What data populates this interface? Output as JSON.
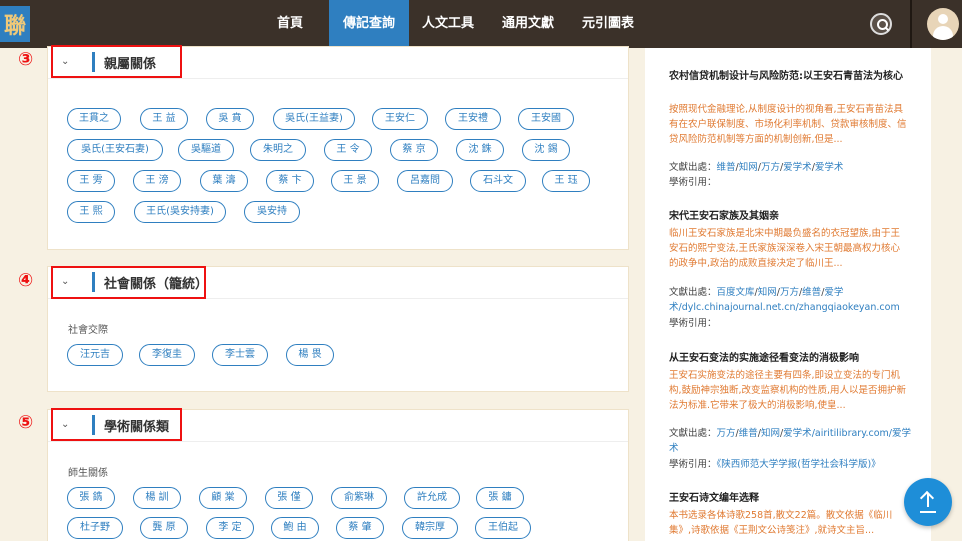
{
  "nav": {
    "logo_glyph": "聯",
    "items": [
      {
        "label": "首頁",
        "active": false
      },
      {
        "label": "傳記查詢",
        "active": true
      },
      {
        "label": "人文工具",
        "active": false
      },
      {
        "label": "通用文獻",
        "active": false
      },
      {
        "label": "元引圖表",
        "active": false
      }
    ]
  },
  "sections": [
    {
      "marker": "③",
      "title": "親屬關係",
      "groups": [
        {
          "label": "",
          "tags": [
            "王貫之",
            "王 益",
            "吳 賁",
            "吳氏(王益妻)",
            "王安仁",
            "王安禮",
            "王安國",
            "吳氏(王安石妻)",
            "吳驅道",
            "朱明之",
            "王 令",
            "蔡 京",
            "沈 銖",
            "沈 錫",
            "王 雱",
            "王 滂",
            "葉 濤",
            "蔡 卞",
            "王 景",
            "呂嘉問",
            "石斗文",
            "王 珏",
            "王 熙",
            "王氏(吳安持妻)",
            "吳安持"
          ]
        }
      ]
    },
    {
      "marker": "④",
      "title": "社會關係（籠統）",
      "groups": [
        {
          "label": "社會交際",
          "tags": [
            "汪元吉",
            "李復圭",
            "李士雲",
            "楊 畏"
          ]
        }
      ]
    },
    {
      "marker": "⑤",
      "title": "學術關係類",
      "groups": [
        {
          "label": "師生關係",
          "tags": [
            "張 鐫",
            "楊 訓",
            "顧 棠",
            "張 僅",
            "俞紫琳",
            "許允成",
            "張 鏞",
            "杜子野",
            "龔 原",
            "李 定",
            "鮑 由",
            "蔡 肇",
            "韓宗厚",
            "王伯起"
          ]
        }
      ]
    }
  ],
  "articles": [
    {
      "title": "农村信贷机制设计与风险防范:以王安石青苗法为核心",
      "excerpt": "按照现代金融理论,从制度设计的视角看,王安石青苗法具有在农户联保制度、市场化利率机制、贷款审核制度、信贷风险防范机制等方面的机制创新,但是...",
      "source_label": "文獻出處：",
      "source_links": [
        "维普",
        "知网",
        "万方",
        "爱学术",
        "爱学术"
      ],
      "source_url": "",
      "cite_label": "學術引用：",
      "cite": ""
    },
    {
      "title": "宋代王安石家族及其姻亲",
      "excerpt": "临川王安石家族是北宋中期最负盛名的衣冠望族,由于王安石的熙宁变法,王氏家族深深卷入宋王朝最高权力核心的政争中,政治的成败直接决定了临川王...",
      "source_label": "文獻出處：",
      "source_links": [
        "百度文库",
        "知网",
        "万方",
        "维普",
        "爱学术"
      ],
      "source_url": "/dylc.chinajournal.net.cn/zhangqiaokeyan.com",
      "cite_label": "學術引用：",
      "cite": ""
    },
    {
      "title": "从王安石变法的实施途径看变法的消极影响",
      "excerpt": "王安石实施变法的途径主要有四条,即设立变法的专门机构,鼓励神宗独断,改变监察机构的性质,用人以是否拥护新法为标准.它带来了极大的消极影响,使皇...",
      "source_label": "文獻出處：",
      "source_links": [
        "万方",
        "维普",
        "知网",
        "爱学术"
      ],
      "source_url": "/airitilibrary.com/爱学术",
      "cite_label": "學術引用：",
      "cite": "《陕西师范大学学报(哲学社会科学版)》"
    },
    {
      "title": "王安石诗文编年选释",
      "excerpt": "本书选录各体诗歌258首,散文22篇。散文依据《临川集》,诗歌依据《王荆文公诗笺注》,就诗文主旨...",
      "source_label": "",
      "source_links": [],
      "source_url": "",
      "cite_label": "",
      "cite": ""
    }
  ],
  "colors": {
    "accent": "#2f7fc0",
    "marker": "#e11111",
    "excerpt": "#e07a32",
    "nav_bg": "#3b3129",
    "page_bg": "#f7f1e3"
  },
  "icons": {
    "search": "search-icon",
    "user": "user-avatar-icon",
    "chevron": "chevron-down-icon",
    "back_to_top": "arrow-up-icon"
  }
}
